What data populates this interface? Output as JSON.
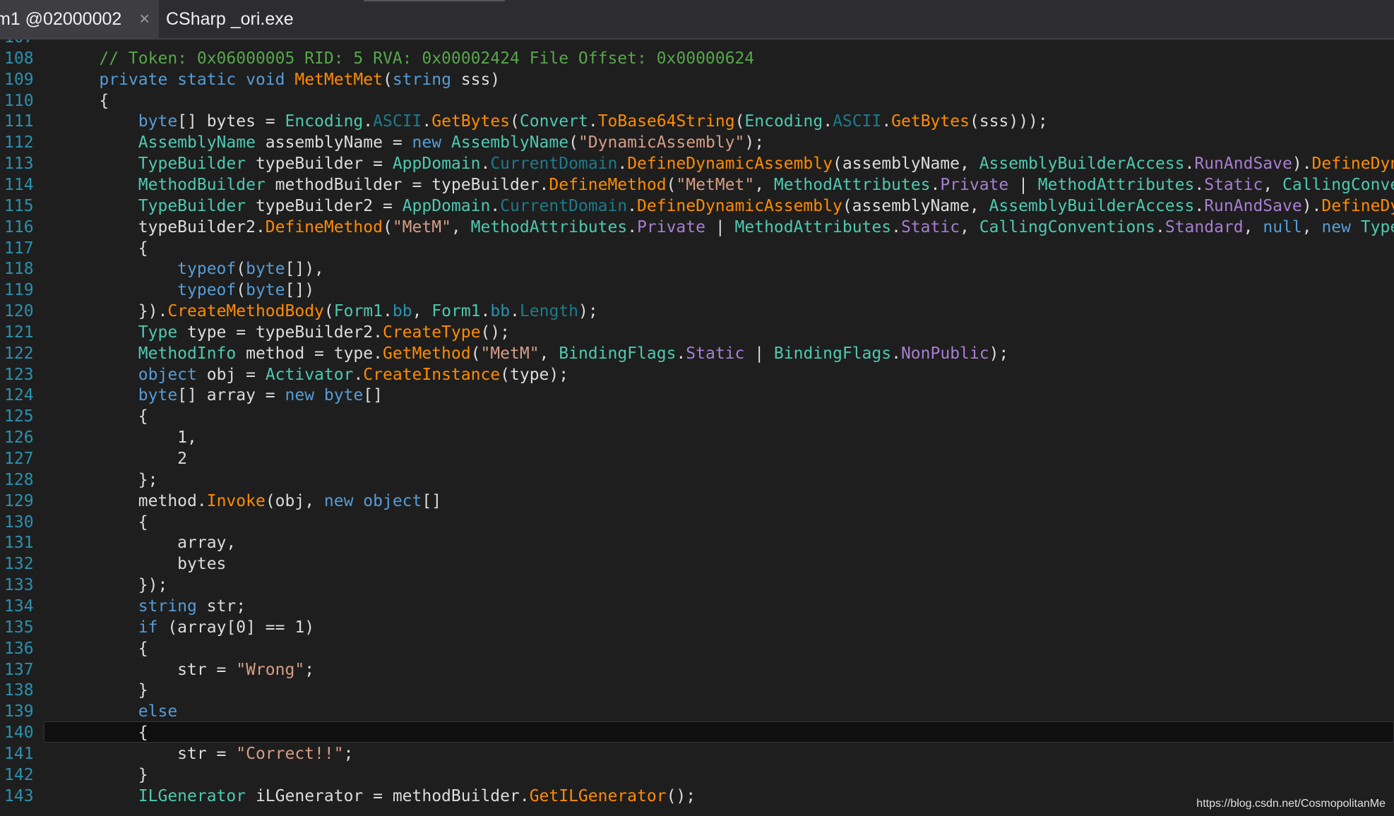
{
  "tabs": [
    {
      "label": "m1 @02000002",
      "close_icon": "×",
      "active": true
    },
    {
      "label": "CSharp _ori.exe",
      "active": false
    }
  ],
  "current_line": 140,
  "watermark": "https://blog.csdn.net/CosmopolitanMe",
  "colors": {
    "background": "#1e1e1e",
    "line_number": "#2b91af",
    "keyword": "#569cd6",
    "type": "#4ec9b0",
    "method": "#ff8c00",
    "property": "#a87ed1",
    "string": "#d69d85",
    "comment": "#57a64a",
    "identifier": "#dcdcdc"
  },
  "lines": [
    {
      "n": "107",
      "tokens": []
    },
    {
      "n": "108",
      "tokens": [
        [
          "cm",
          "    // Token: 0x06000005 RID: 5 RVA: 0x00002424 File Offset: 0x00000624"
        ]
      ]
    },
    {
      "n": "109",
      "tokens": [
        [
          "kw",
          "    private static void "
        ],
        [
          "mt",
          "MetMetMet"
        ],
        [
          "id",
          "("
        ],
        [
          "kw",
          "string"
        ],
        [
          "id",
          " sss)"
        ]
      ]
    },
    {
      "n": "110",
      "tokens": [
        [
          "id",
          "    {"
        ]
      ]
    },
    {
      "n": "111",
      "tokens": [
        [
          "kw",
          "        byte"
        ],
        [
          "id",
          "[] bytes = "
        ],
        [
          "ty",
          "Encoding"
        ],
        [
          "id",
          "."
        ],
        [
          "sp",
          "ASCII"
        ],
        [
          "id",
          "."
        ],
        [
          "mt",
          "GetBytes"
        ],
        [
          "id",
          "("
        ],
        [
          "ty",
          "Convert"
        ],
        [
          "id",
          "."
        ],
        [
          "mt",
          "ToBase64String"
        ],
        [
          "id",
          "("
        ],
        [
          "ty",
          "Encoding"
        ],
        [
          "id",
          "."
        ],
        [
          "sp",
          "ASCII"
        ],
        [
          "id",
          "."
        ],
        [
          "mt",
          "GetBytes"
        ],
        [
          "id",
          "(sss)));"
        ]
      ]
    },
    {
      "n": "112",
      "tokens": [
        [
          "ty",
          "        AssemblyName"
        ],
        [
          "id",
          " assemblyName = "
        ],
        [
          "kw",
          "new "
        ],
        [
          "ty",
          "AssemblyName"
        ],
        [
          "id",
          "("
        ],
        [
          "st",
          "\"DynamicAssembly\""
        ],
        [
          "id",
          ");"
        ]
      ]
    },
    {
      "n": "113",
      "tokens": [
        [
          "ty",
          "        TypeBuilder"
        ],
        [
          "id",
          " typeBuilder = "
        ],
        [
          "ty",
          "AppDomain"
        ],
        [
          "id",
          "."
        ],
        [
          "sp",
          "CurrentDomain"
        ],
        [
          "id",
          "."
        ],
        [
          "mt",
          "DefineDynamicAssembly"
        ],
        [
          "id",
          "(assemblyName, "
        ],
        [
          "ty",
          "AssemblyBuilderAccess"
        ],
        [
          "id",
          "."
        ],
        [
          "pr",
          "RunAndSave"
        ],
        [
          "id",
          ")."
        ],
        [
          "mt",
          "DefineDynamicModule"
        ]
      ]
    },
    {
      "n": "114",
      "tokens": [
        [
          "ty",
          "        MethodBuilder"
        ],
        [
          "id",
          " methodBuilder = typeBuilder."
        ],
        [
          "mt",
          "DefineMethod"
        ],
        [
          "id",
          "("
        ],
        [
          "st",
          "\"MetMet\""
        ],
        [
          "id",
          ", "
        ],
        [
          "ty",
          "MethodAttributes"
        ],
        [
          "id",
          "."
        ],
        [
          "pr",
          "Private"
        ],
        [
          "id",
          " | "
        ],
        [
          "ty",
          "MethodAttributes"
        ],
        [
          "id",
          "."
        ],
        [
          "pr",
          "Static"
        ],
        [
          "id",
          ", "
        ],
        [
          "ty",
          "CallingConventions"
        ]
      ]
    },
    {
      "n": "115",
      "tokens": [
        [
          "ty",
          "        TypeBuilder"
        ],
        [
          "id",
          " typeBuilder2 = "
        ],
        [
          "ty",
          "AppDomain"
        ],
        [
          "id",
          "."
        ],
        [
          "sp",
          "CurrentDomain"
        ],
        [
          "id",
          "."
        ],
        [
          "mt",
          "DefineDynamicAssembly"
        ],
        [
          "id",
          "(assemblyName, "
        ],
        [
          "ty",
          "AssemblyBuilderAccess"
        ],
        [
          "id",
          "."
        ],
        [
          "pr",
          "RunAndSave"
        ],
        [
          "id",
          ")."
        ],
        [
          "mt",
          "DefineDynamicModule"
        ]
      ]
    },
    {
      "n": "116",
      "tokens": [
        [
          "id",
          "        typeBuilder2."
        ],
        [
          "mt",
          "DefineMethod"
        ],
        [
          "id",
          "("
        ],
        [
          "st",
          "\"MetM\""
        ],
        [
          "id",
          ", "
        ],
        [
          "ty",
          "MethodAttributes"
        ],
        [
          "id",
          "."
        ],
        [
          "pr",
          "Private"
        ],
        [
          "id",
          " | "
        ],
        [
          "ty",
          "MethodAttributes"
        ],
        [
          "id",
          "."
        ],
        [
          "pr",
          "Static"
        ],
        [
          "id",
          ", "
        ],
        [
          "ty",
          "CallingConventions"
        ],
        [
          "id",
          "."
        ],
        [
          "pr",
          "Standard"
        ],
        [
          "id",
          ", "
        ],
        [
          "kw",
          "null"
        ],
        [
          "id",
          ", "
        ],
        [
          "kw",
          "new "
        ],
        [
          "ty",
          "Type"
        ],
        [
          "id",
          "[]"
        ]
      ]
    },
    {
      "n": "117",
      "tokens": [
        [
          "id",
          "        {"
        ]
      ]
    },
    {
      "n": "118",
      "tokens": [
        [
          "kw",
          "            typeof"
        ],
        [
          "id",
          "("
        ],
        [
          "kw",
          "byte"
        ],
        [
          "id",
          "[]),"
        ]
      ]
    },
    {
      "n": "119",
      "tokens": [
        [
          "kw",
          "            typeof"
        ],
        [
          "id",
          "("
        ],
        [
          "kw",
          "byte"
        ],
        [
          "id",
          "[])"
        ]
      ]
    },
    {
      "n": "120",
      "tokens": [
        [
          "id",
          "        })."
        ],
        [
          "mt",
          "CreateMethodBody"
        ],
        [
          "id",
          "("
        ],
        [
          "ty",
          "Form1"
        ],
        [
          "id",
          "."
        ],
        [
          "fd",
          "bb"
        ],
        [
          "id",
          ", "
        ],
        [
          "ty",
          "Form1"
        ],
        [
          "id",
          "."
        ],
        [
          "fd",
          "bb"
        ],
        [
          "id",
          "."
        ],
        [
          "sp",
          "Length"
        ],
        [
          "id",
          ");"
        ]
      ]
    },
    {
      "n": "121",
      "tokens": [
        [
          "ty",
          "        Type"
        ],
        [
          "id",
          " type = typeBuilder2."
        ],
        [
          "mt",
          "CreateType"
        ],
        [
          "id",
          "();"
        ]
      ]
    },
    {
      "n": "122",
      "tokens": [
        [
          "ty",
          "        MethodInfo"
        ],
        [
          "id",
          " method = type."
        ],
        [
          "mt",
          "GetMethod"
        ],
        [
          "id",
          "("
        ],
        [
          "st",
          "\"MetM\""
        ],
        [
          "id",
          ", "
        ],
        [
          "ty",
          "BindingFlags"
        ],
        [
          "id",
          "."
        ],
        [
          "pr",
          "Static"
        ],
        [
          "id",
          " | "
        ],
        [
          "ty",
          "BindingFlags"
        ],
        [
          "id",
          "."
        ],
        [
          "pr",
          "NonPublic"
        ],
        [
          "id",
          ");"
        ]
      ]
    },
    {
      "n": "123",
      "tokens": [
        [
          "kw",
          "        object"
        ],
        [
          "id",
          " obj = "
        ],
        [
          "ty",
          "Activator"
        ],
        [
          "id",
          "."
        ],
        [
          "mt",
          "CreateInstance"
        ],
        [
          "id",
          "(type);"
        ]
      ]
    },
    {
      "n": "124",
      "tokens": [
        [
          "kw",
          "        byte"
        ],
        [
          "id",
          "[] array = "
        ],
        [
          "kw",
          "new byte"
        ],
        [
          "id",
          "[]"
        ]
      ]
    },
    {
      "n": "125",
      "tokens": [
        [
          "id",
          "        {"
        ]
      ]
    },
    {
      "n": "126",
      "tokens": [
        [
          "id",
          "            1,"
        ]
      ]
    },
    {
      "n": "127",
      "tokens": [
        [
          "id",
          "            2"
        ]
      ]
    },
    {
      "n": "128",
      "tokens": [
        [
          "id",
          "        };"
        ]
      ]
    },
    {
      "n": "129",
      "tokens": [
        [
          "id",
          "        method."
        ],
        [
          "mt",
          "Invoke"
        ],
        [
          "id",
          "(obj, "
        ],
        [
          "kw",
          "new object"
        ],
        [
          "id",
          "[]"
        ]
      ]
    },
    {
      "n": "130",
      "tokens": [
        [
          "id",
          "        {"
        ]
      ]
    },
    {
      "n": "131",
      "tokens": [
        [
          "id",
          "            array,"
        ]
      ]
    },
    {
      "n": "132",
      "tokens": [
        [
          "id",
          "            bytes"
        ]
      ]
    },
    {
      "n": "133",
      "tokens": [
        [
          "id",
          "        });"
        ]
      ]
    },
    {
      "n": "134",
      "tokens": [
        [
          "kw",
          "        string"
        ],
        [
          "id",
          " str;"
        ]
      ]
    },
    {
      "n": "135",
      "tokens": [
        [
          "kw",
          "        if"
        ],
        [
          "id",
          " (array[0] == 1)"
        ]
      ]
    },
    {
      "n": "136",
      "tokens": [
        [
          "id",
          "        {"
        ]
      ]
    },
    {
      "n": "137",
      "tokens": [
        [
          "id",
          "            str = "
        ],
        [
          "st",
          "\"Wrong\""
        ],
        [
          "id",
          ";"
        ]
      ]
    },
    {
      "n": "138",
      "tokens": [
        [
          "id",
          "        }"
        ]
      ]
    },
    {
      "n": "139",
      "tokens": [
        [
          "kw",
          "        else"
        ]
      ]
    },
    {
      "n": "140",
      "tokens": [
        [
          "id",
          "        {"
        ]
      ]
    },
    {
      "n": "141",
      "tokens": [
        [
          "id",
          "            str = "
        ],
        [
          "st",
          "\"Correct!!\""
        ],
        [
          "id",
          ";"
        ]
      ]
    },
    {
      "n": "142",
      "tokens": [
        [
          "id",
          "        }"
        ]
      ]
    },
    {
      "n": "143",
      "tokens": [
        [
          "ty",
          "        ILGenerator"
        ],
        [
          "id",
          " iLGenerator = methodBuilder."
        ],
        [
          "mt",
          "GetILGenerator"
        ],
        [
          "id",
          "();"
        ]
      ]
    }
  ]
}
